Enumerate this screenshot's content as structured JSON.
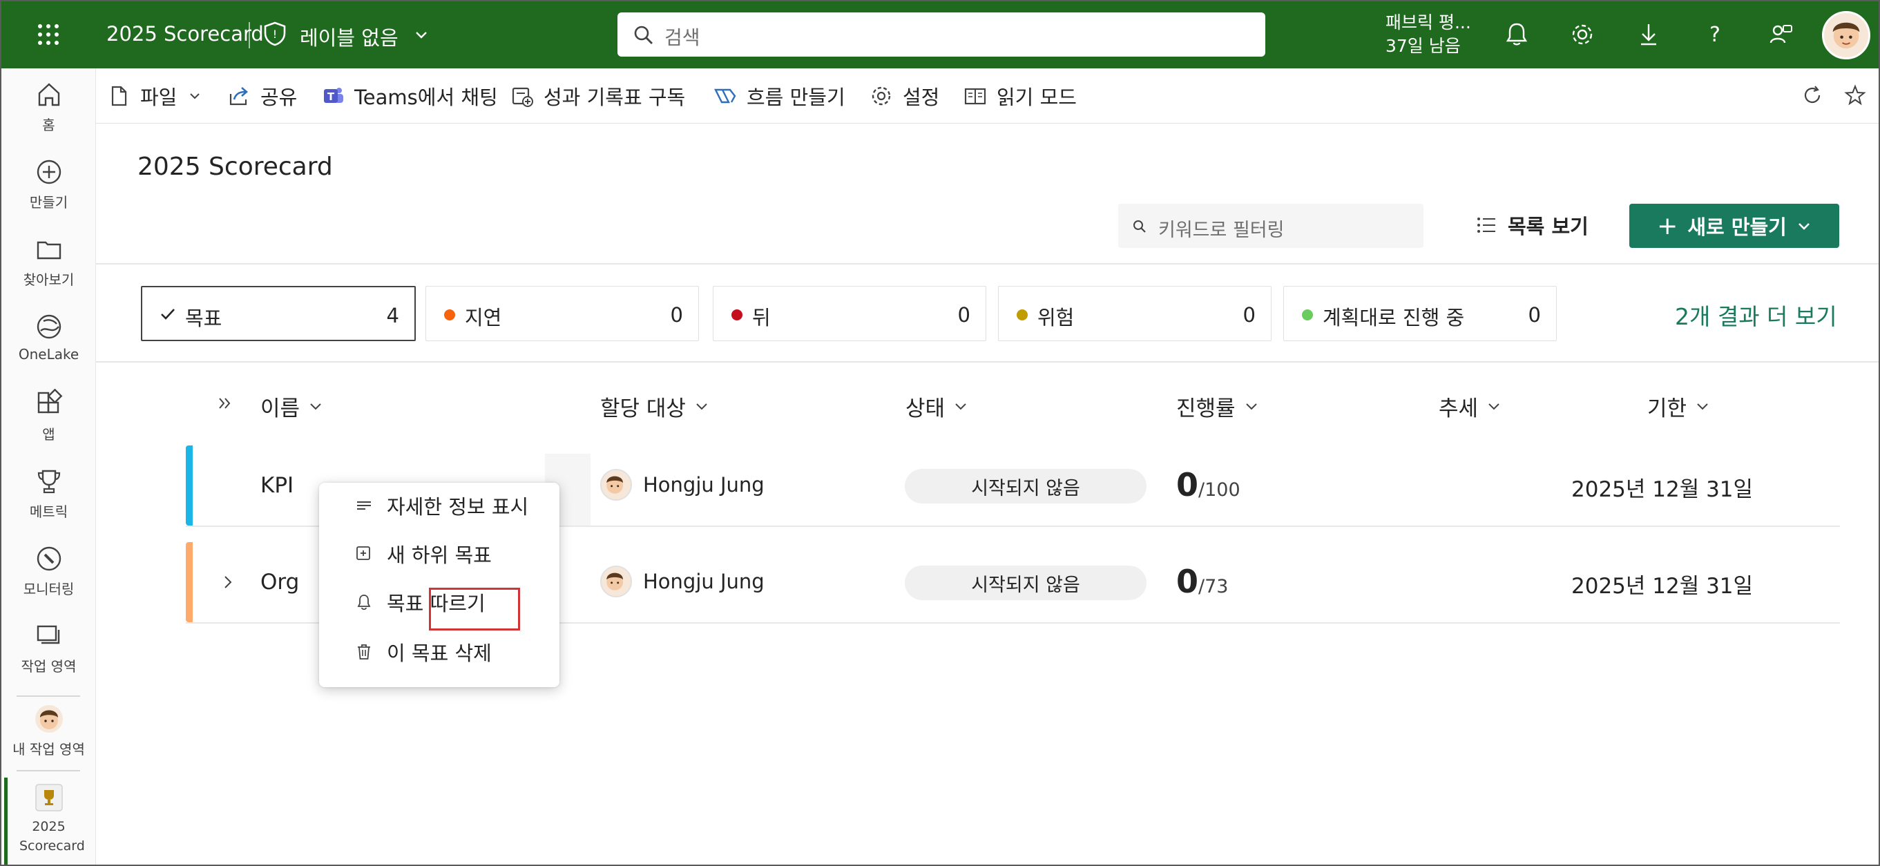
{
  "topbar": {
    "app_title": "2025 Scorecard",
    "sensitivity_label": "레이블 없음",
    "search_placeholder": "검색",
    "trial_line1": "패브릭 평...",
    "trial_line2": "37일 남음"
  },
  "rail": {
    "items": [
      {
        "label": "홈",
        "icon": "home-icon"
      },
      {
        "label": "만들기",
        "icon": "create-icon"
      },
      {
        "label": "찾아보기",
        "icon": "browse-icon"
      },
      {
        "label": "OneLake",
        "icon": "onelake-icon"
      },
      {
        "label": "앱",
        "icon": "apps-icon"
      },
      {
        "label": "메트릭",
        "icon": "metrics-icon"
      },
      {
        "label": "모니터링",
        "icon": "monitor-icon"
      },
      {
        "label": "작업 영역",
        "icon": "workspaces-icon"
      },
      {
        "label": "내 작업 영역",
        "icon": "my-workspace-avatar"
      },
      {
        "label": "2025 Scorecard",
        "icon": "scorecard-icon"
      }
    ]
  },
  "commandbar": {
    "file": "파일",
    "share": "공유",
    "teams_chat": "Teams에서 채팅",
    "subscribe": "성과 기록표 구독",
    "create_flow": "흐름 만들기",
    "settings": "설정",
    "reading_mode": "읽기 모드"
  },
  "page": {
    "title": "2025 Scorecard",
    "filter_placeholder": "키워드로 필터링",
    "list_view": "목록 보기",
    "new_button": "새로 만들기"
  },
  "status_cards": [
    {
      "label": "목표",
      "count": "4",
      "selected": true,
      "color": ""
    },
    {
      "label": "지연",
      "count": "0",
      "color": "#f7630c"
    },
    {
      "label": "뒤",
      "count": "0",
      "color": "#c50f1f"
    },
    {
      "label": "위험",
      "count": "0",
      "color": "#c19c00"
    },
    {
      "label": "계획대로 진행 중",
      "count": "0",
      "color": "#6ccb5f"
    }
  ],
  "more_results": "2개 결과 더 보기",
  "table": {
    "headers": {
      "name": "이름",
      "owner": "할당 대상",
      "status": "상태",
      "progress": "진행률",
      "trend": "추세",
      "due": "기한"
    },
    "rows": [
      {
        "name": "KPI",
        "owner": "Hongju Jung",
        "status": "시작되지 않음",
        "value": "0",
        "target": "/100",
        "due": "2025년 12월 31일",
        "accent": "#1cb5e8"
      },
      {
        "name": "Org",
        "owner": "Hongju Jung",
        "status": "시작되지 않음",
        "value": "0",
        "target": "/73",
        "due": "2025년 12월 31일",
        "accent": "#ffaa6b"
      }
    ]
  },
  "context_menu": {
    "details": "자세한 정보 표시",
    "new_subgoal": "새 하위 목표",
    "follow_goal": "목표 따르기",
    "delete_goal": "이 목표 삭제"
  }
}
